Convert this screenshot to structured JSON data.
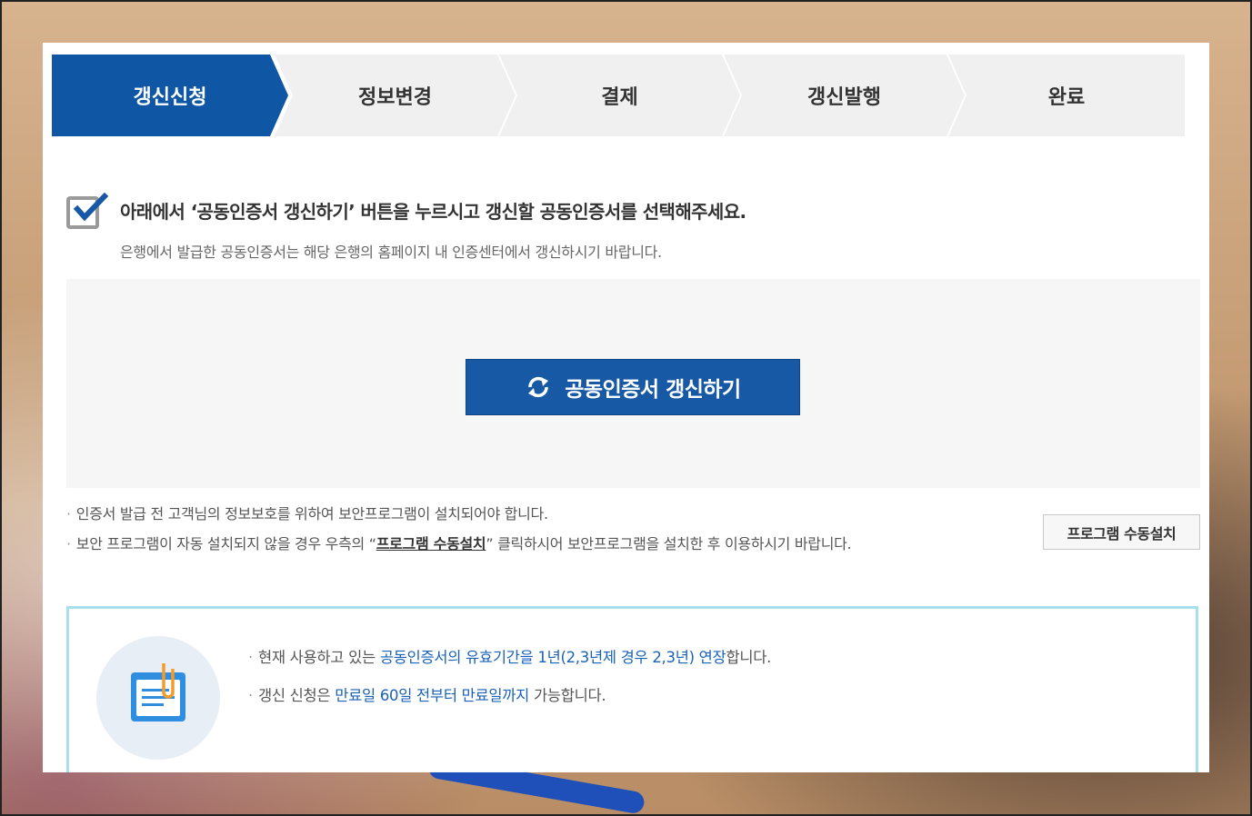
{
  "steps": [
    {
      "label": "갱신신청",
      "active": true
    },
    {
      "label": "정보변경",
      "active": false
    },
    {
      "label": "결제",
      "active": false
    },
    {
      "label": "갱신발행",
      "active": false
    },
    {
      "label": "완료",
      "active": false
    }
  ],
  "instruction": {
    "title": "아래에서 ‘공동인증서 갱신하기’ 버튼을 누르시고 갱신할 공동인증서를 선택해주세요.",
    "subtitle": "은행에서 발급한 공동인증서는 해당 은행의 홈페이지 내 인증센터에서 갱신하시기 바랍니다."
  },
  "renew_button": {
    "label": "공동인증서 갱신하기",
    "icon": "refresh-icon"
  },
  "notes": {
    "line1": "인증서 발급 전 고객님의 정보보호를 위하여 보안프로그램이 설치되어야 합니다.",
    "line2_before": "보안 프로그램이 자동 설치되지 않을 경우 우측의 “",
    "line2_link": "프로그램 수동설치",
    "line2_after": "” 클릭하시어 보안프로그램을 설치한 후 이용하시기 바랍니다.",
    "bullet": "·"
  },
  "manual_install_button": {
    "label": "프로그램 수동설치"
  },
  "info": {
    "icon": "document-clip-icon",
    "line1_a": "현재 사용하고 있는 ",
    "line1_hl": "공동인증서의 유효기간을 1년(2,3년제 경우 2,3년) 연장",
    "line1_b": "합니다.",
    "line2_a": "갱신 신청은 ",
    "line2_hl": "만료일 60일 전부터 만료일까지",
    "line2_b": " 가능합니다."
  },
  "colors": {
    "active_step": "#0f57a5",
    "inactive_step": "#f0f0f0",
    "button_blue": "#1859a6",
    "highlight_text": "#1a62b8",
    "info_border": "#a7dfee"
  }
}
